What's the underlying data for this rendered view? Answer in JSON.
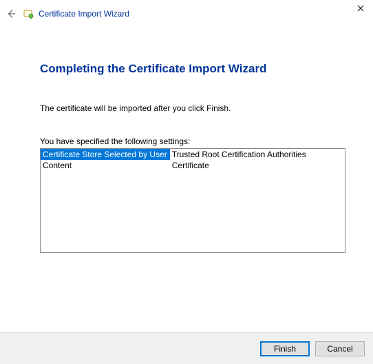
{
  "window": {
    "title": "Certificate Import Wizard"
  },
  "page": {
    "heading": "Completing the Certificate Import Wizard",
    "description": "The certificate will be imported after you click Finish.",
    "settings_label": "You have specified the following settings:"
  },
  "settings": {
    "rows": [
      {
        "key": "Certificate Store Selected by User",
        "value": "Trusted Root Certification Authorities"
      },
      {
        "key": "Content",
        "value": "Certificate"
      }
    ]
  },
  "buttons": {
    "finish": "Finish",
    "cancel": "Cancel"
  }
}
